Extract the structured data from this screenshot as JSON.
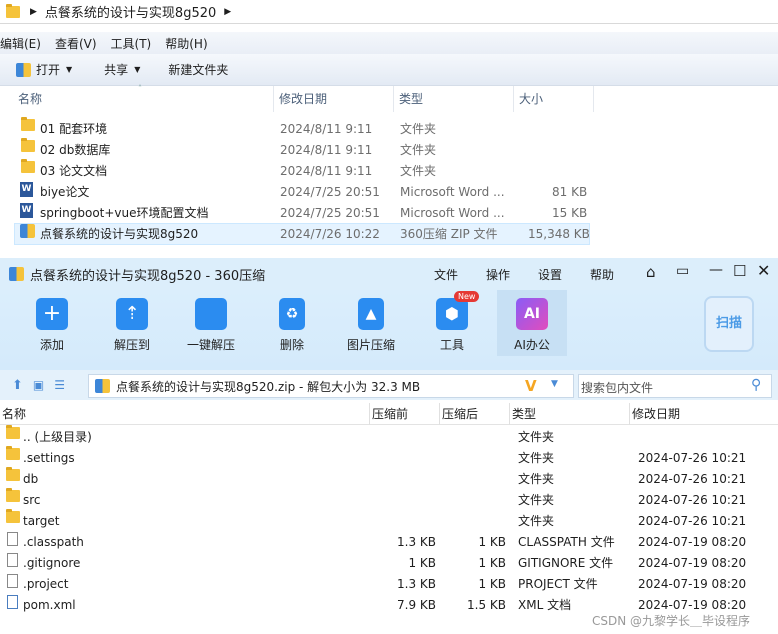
{
  "explorer": {
    "breadcrumb": "点餐系统的设计与实现8g520",
    "menu": [
      "编辑(E)",
      "查看(V)",
      "工具(T)",
      "帮助(H)"
    ],
    "toolbar": {
      "open": "打开",
      "share": "共享",
      "new_folder": "新建文件夹"
    },
    "columns": {
      "name": "名称",
      "date": "修改日期",
      "type": "类型",
      "size": "大小"
    },
    "files": [
      {
        "name": "01 配套环境",
        "date": "2024/8/11 9:11",
        "type": "文件夹",
        "size": "",
        "icon": "folder"
      },
      {
        "name": "02 db数据库",
        "date": "2024/8/11 9:11",
        "type": "文件夹",
        "size": "",
        "icon": "folder"
      },
      {
        "name": "03 论文文档",
        "date": "2024/8/11 9:11",
        "type": "文件夹",
        "size": "",
        "icon": "folder"
      },
      {
        "name": "biye论文",
        "date": "2024/7/25 20:51",
        "type": "Microsoft Word ...",
        "size": "81 KB",
        "icon": "word"
      },
      {
        "name": "springboot+vue环境配置文档",
        "date": "2024/7/25 20:51",
        "type": "Microsoft Word ...",
        "size": "15 KB",
        "icon": "word"
      },
      {
        "name": "点餐系统的设计与实现8g520",
        "date": "2024/7/26 10:22",
        "type": "360压缩 ZIP 文件",
        "size": "15,348 KB",
        "icon": "zip"
      }
    ]
  },
  "zip": {
    "title": "点餐系统的设计与实现8g520 - 360压缩",
    "menu": [
      "文件",
      "操作",
      "设置",
      "帮助"
    ],
    "ribbon": [
      {
        "label": "添加",
        "icon": "add-icon"
      },
      {
        "label": "解压到",
        "icon": "extract-to-icon"
      },
      {
        "label": "一键解压",
        "icon": "one-click-extract-icon"
      },
      {
        "label": "删除",
        "icon": "delete-icon"
      },
      {
        "label": "图片压缩",
        "icon": "image-compress-icon"
      },
      {
        "label": "工具",
        "icon": "tools-icon"
      },
      {
        "label": "AI办公",
        "icon": "ai-office-icon"
      }
    ],
    "new_badge": "New",
    "ai_text": "AI",
    "scan_label": "扫描",
    "path": "点餐系统的设计与实现8g520.zip - 解包大小为 32.3 MB",
    "search_placeholder": "搜索包内文件",
    "columns": {
      "name": "名称",
      "compressed_before": "压缩前",
      "compressed_after": "压缩后",
      "type": "类型",
      "date": "修改日期"
    },
    "files": [
      {
        "name": ".. (上级目录)",
        "before": "",
        "after": "",
        "type": "文件夹",
        "date": "",
        "icon": "folder"
      },
      {
        "name": ".settings",
        "before": "",
        "after": "",
        "type": "文件夹",
        "date": "2024-07-26 10:21",
        "icon": "folder"
      },
      {
        "name": "db",
        "before": "",
        "after": "",
        "type": "文件夹",
        "date": "2024-07-26 10:21",
        "icon": "folder"
      },
      {
        "name": "src",
        "before": "",
        "after": "",
        "type": "文件夹",
        "date": "2024-07-26 10:21",
        "icon": "folder"
      },
      {
        "name": "target",
        "before": "",
        "after": "",
        "type": "文件夹",
        "date": "2024-07-26 10:21",
        "icon": "folder"
      },
      {
        "name": ".classpath",
        "before": "1.3 KB",
        "after": "1 KB",
        "type": "CLASSPATH 文件",
        "date": "2024-07-19 08:20",
        "icon": "file"
      },
      {
        "name": ".gitignore",
        "before": "1 KB",
        "after": "1 KB",
        "type": "GITIGNORE 文件",
        "date": "2024-07-19 08:20",
        "icon": "file"
      },
      {
        "name": ".project",
        "before": "1.3 KB",
        "after": "1 KB",
        "type": "PROJECT 文件",
        "date": "2024-07-19 08:20",
        "icon": "file"
      },
      {
        "name": "pom.xml",
        "before": "7.9 KB",
        "after": "1.5 KB",
        "type": "XML 文档",
        "date": "2024-07-19 08:20",
        "icon": "xml"
      }
    ]
  },
  "watermark": "CSDN @九黎学长＿毕设程序"
}
